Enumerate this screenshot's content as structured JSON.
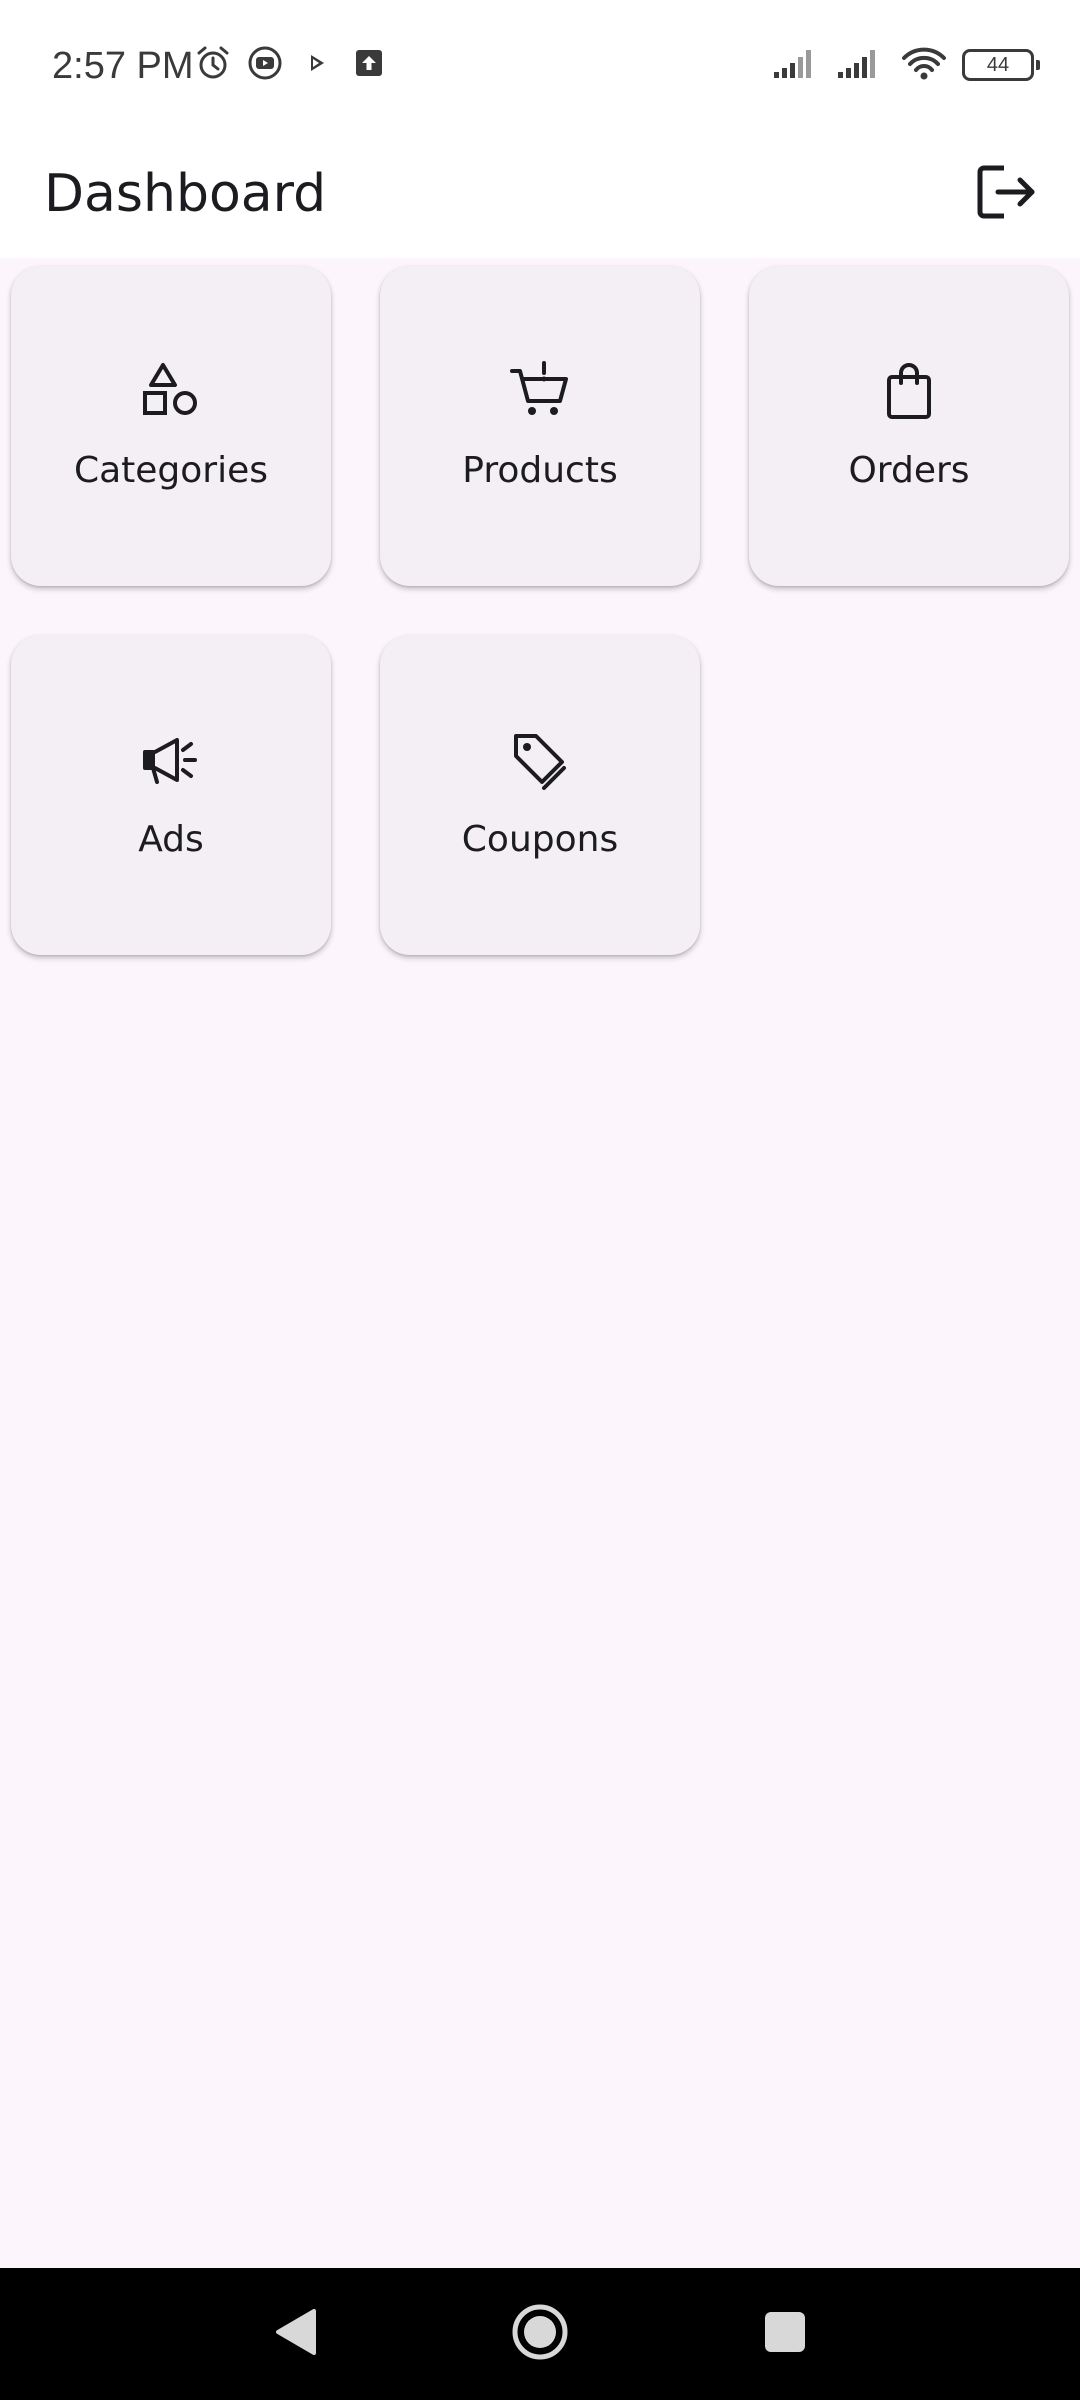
{
  "status_bar": {
    "time": "2:57 PM",
    "battery_level": "44",
    "icons": [
      "alarm-icon",
      "media-icon",
      "play-icon",
      "upload-icon",
      "signal-icon",
      "signal-icon",
      "wifi-icon",
      "battery-icon"
    ]
  },
  "header": {
    "title": "Dashboard",
    "logout_icon": "logout-icon"
  },
  "dashboard": {
    "items": [
      {
        "label": "Categories",
        "icon": "categories-icon"
      },
      {
        "label": "Products",
        "icon": "cart-icon"
      },
      {
        "label": "Orders",
        "icon": "shopping-bag-icon"
      },
      {
        "label": "Ads",
        "icon": "megaphone-icon"
      },
      {
        "label": "Coupons",
        "icon": "tag-icon"
      }
    ]
  },
  "navigation": {
    "buttons": [
      "back-icon",
      "home-icon",
      "recents-icon"
    ]
  },
  "colors": {
    "background": "#fcf6fc",
    "card": "#f4eff5",
    "text": "#1c1b1f"
  }
}
